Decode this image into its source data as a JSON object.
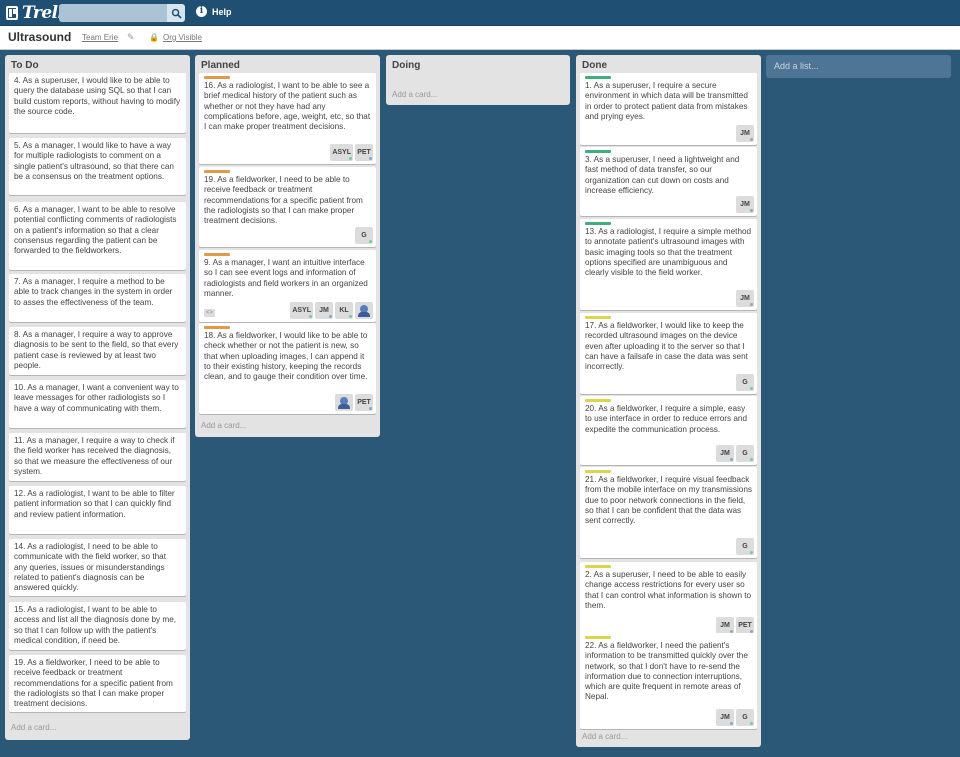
{
  "header": {
    "logo_text": "Trello",
    "search_placeholder": "",
    "help_label": "Help"
  },
  "board": {
    "title": "Ultrasound",
    "team": "Team Erie",
    "visibility": "Org Visible"
  },
  "lists": [
    {
      "title": "To Do",
      "add_card": "Add a card...",
      "cards": [
        {
          "text": "4. As a superuser, I would like to be able to query the database using SQL so that I can build custom reports, without having to modify the source code."
        },
        {
          "text": "5. As a manager, I would like to have a way for multiple radiologists to comment on a single patient's ultrasound, so that there can be a consensus on the treatment options."
        },
        {
          "text": "6. As a manager, I want to be able to resolve potential conflicting comments of radiologists on a patient's information so that a clear consensus regarding the patient can be forwarded to the fieldworkers."
        },
        {
          "text": "7. As a manager, I require a method to be able to track changes in the system in order to asses the effectiveness of the team."
        },
        {
          "text": "8. As a manager, I require a way to approve diagnosis to be sent to the field, so that every patient case is reviewed by at least two people."
        },
        {
          "text": "10. As a manager, I want a convenient way to leave messages for other radiologists so I have a way of communicating with them."
        },
        {
          "text": "11. As a manager, I require a way to check if the field worker has received the diagnosis, so that we measure the effectiveness of our system."
        },
        {
          "text": "12. As a radiologist, I want to be able to filter patient information so that I can quickly find and review patient information."
        },
        {
          "text": "14. As a radiologist, I need to be able to communicate with the field worker, so that any queries, issues or misunderstandings related to patient's diagnosis can be answered quickly."
        },
        {
          "text": "15. As a radiologist, I want to be able to access and list all the diagnosis done by me, so that I can follow up with the patient's medical condition, if need be."
        },
        {
          "text": "19. As a fieldworker, I need to be able to receive feedback or treatment recommendations for a specific patient from the radiologists so that I can make proper treatment decisions."
        }
      ]
    },
    {
      "title": "Planned",
      "add_card": "Add a card...",
      "cards": [
        {
          "text": "16. As a radiologist, I want to be able to see a brief medical history of the patient such as whether or not they have had any complications before, age, weight, etc, so that I can make proper treatment decisions.",
          "label_color": "#e09a4a",
          "members": [
            "ASYL",
            "PET"
          ]
        },
        {
          "text": "19. As a fieldworker, I need to be able to receive feedback or treatment recommendations for a specific patient from the radiologists so that I can make proper treatment decisions.",
          "label_color": "#e09a4a",
          "members": [
            "G"
          ]
        },
        {
          "text": "9. As a manager, I want an intuitive interface so I can see event logs and information of radiologists and field workers in an organized manner.",
          "label_color": "#e09a4a",
          "members": [
            "ASYL",
            "JM",
            "KL",
            "avatar"
          ]
        },
        {
          "text": "18. As a fieldworker, I would like to be able to check whether or not the patient is new, so that when uploading images, I can append it to their existing history, keeping the records clean, and to gauge their condition over time.",
          "label_color": "#e09a4a",
          "members": [
            "avatar",
            "PET"
          ]
        }
      ]
    },
    {
      "title": "Doing",
      "add_card": "Add a card...",
      "cards": []
    },
    {
      "title": "Done",
      "add_card": "Add a card...",
      "cards": [
        {
          "text": "1. As a superuser, I require a secure environment in which data will be transmitted in order to protect patient data from mistakes and prying eyes.",
          "label_color": "#3fae7a",
          "members": [
            "JM"
          ]
        },
        {
          "text": "3. As a superuser, I need a lightweight and fast method of data transfer, so our organization can cut down on costs and increase efficiency.",
          "label_color": "#3fae7a",
          "members": [
            "JM"
          ]
        },
        {
          "text": "13. As a radiologist, I require a simple method to annotate patient's ultrasound images with basic imaging tools so that the treatment options specified are unambiguous and clearly visible to the field worker.",
          "label_color": "#3fae7a",
          "members": [
            "JM"
          ]
        },
        {
          "text": "17. As a fieldworker, I would like to keep the recorded ultrasound images on the device even after uploading it to the server so that I can have a failsafe in case the data was sent incorrectly.",
          "label_color": "#d9d64c",
          "members": [
            "G"
          ]
        },
        {
          "text": "20. As a fieldworker, I require a simple, easy to use interface in order to reduce errors and expedite the communication process.",
          "label_color": "#d9d64c",
          "members": [
            "JM",
            "G"
          ]
        },
        {
          "text": "21. As a fieldworker, I require visual feedback from the mobile interface on my transmissions due to poor network connections in the field, so that I can be confident that the data was sent correctly.",
          "label_color": "#d9d64c",
          "members": [
            "G"
          ]
        },
        {
          "text": "2. As a superuser, I need to be able to easily change access restrictions for every user so that I can control what information is shown to them.",
          "label_color": "#d9d64c",
          "members": [
            "JM",
            "PET"
          ]
        },
        {
          "text": "22. As a fieldworker, I need the patient's information to be transmitted quickly over the network, so that I don't have to re-send the information due to connection interruptions, which are quite frequent in remote areas of Nepal.",
          "label_color": "#d9d64c",
          "members": [
            "JM",
            "G"
          ]
        }
      ]
    }
  ],
  "add_list": "Add a list..."
}
